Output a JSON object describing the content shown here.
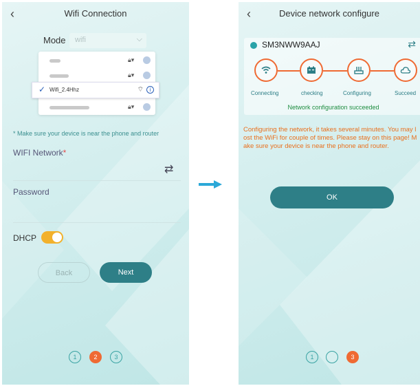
{
  "colors": {
    "accent": "#2e7f87",
    "active_step": "#ef6a33",
    "success": "#1d8c3f",
    "warning": "#e96f1c",
    "toggle_on": "#f2b12c"
  },
  "left_screen": {
    "title": "Wifi Connection",
    "back_icon": "chevron-left-icon",
    "mode_label": "Mode",
    "mode_value": "wifi",
    "selected_network": "Wifi_2.4Hhz",
    "hint": "* Make sure your device is near the phone and router",
    "wifi_network_label": "WIFI Network",
    "required_mark": "*",
    "password_label": "Password",
    "dhcp_label": "DHCP",
    "dhcp_on": true,
    "back_button": "Back",
    "next_button": "Next",
    "steps": [
      "1",
      "2",
      "3"
    ],
    "active_step": 2
  },
  "right_screen": {
    "title": "Device network configure",
    "device_name": "SM3NWW9AAJ",
    "stages": [
      {
        "label": "Connecting",
        "icon": "wifi-icon"
      },
      {
        "label": "checking",
        "icon": "battery-icon"
      },
      {
        "label": "Configuring",
        "icon": "router-icon"
      },
      {
        "label": "Succeed",
        "icon": "cloud-icon"
      }
    ],
    "success_message": "Network configuration succeeded",
    "warning": "Configuring the network, it takes several minutes. You may lost the WiFi for couple of times. Please stay on this page! Make sure your device is near the phone and router.",
    "ok_button": "OK",
    "steps": [
      "1",
      "",
      "3"
    ],
    "active_step": 3
  }
}
